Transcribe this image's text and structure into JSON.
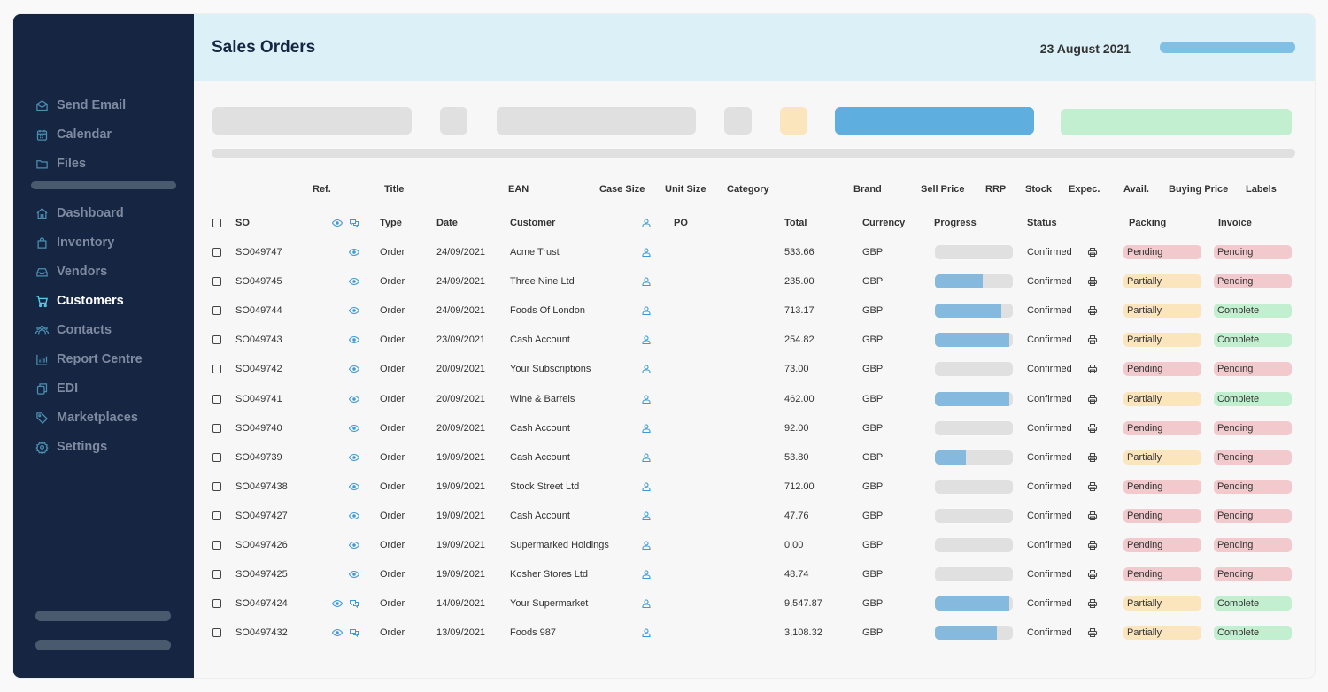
{
  "sidebar": {
    "top_items": [
      {
        "label": "Send Email",
        "icon": "mail-open-icon"
      },
      {
        "label": "Calendar",
        "icon": "calendar-icon"
      },
      {
        "label": "Files",
        "icon": "folder-icon"
      }
    ],
    "items": [
      {
        "label": "Dashboard",
        "icon": "home-icon"
      },
      {
        "label": "Inventory",
        "icon": "shopping-bag-icon"
      },
      {
        "label": "Vendors",
        "icon": "inbox-icon"
      },
      {
        "label": "Customers",
        "icon": "cart-icon",
        "active": true
      },
      {
        "label": "Contacts",
        "icon": "users-icon"
      },
      {
        "label": "Report Centre",
        "icon": "bar-chart-icon"
      },
      {
        "label": "EDI",
        "icon": "copy-icon"
      },
      {
        "label": "Marketplaces",
        "icon": "tag-icon"
      },
      {
        "label": "Settings",
        "icon": "gear-icon"
      }
    ]
  },
  "header": {
    "title": "Sales Orders",
    "date": "23 August 2021"
  },
  "colors": {
    "sidebar_bg": "#152542",
    "header_bg": "#dbf0f7",
    "accent_blue": "#5faee0",
    "pending": "#f2c9cd",
    "partially": "#fbe5bd",
    "complete": "#c2efcf"
  },
  "table": {
    "secondary_headers": [
      "Ref.",
      "Title",
      "EAN",
      "Case Size",
      "Unit Size",
      "Category",
      "Brand",
      "Sell Price",
      "RRP",
      "Stock",
      "Expec.",
      "Avail.",
      "Buying Price",
      "Labels"
    ],
    "headers": {
      "so": "SO",
      "type": "Type",
      "date": "Date",
      "customer": "Customer",
      "po": "PO",
      "total": "Total",
      "currency": "Currency",
      "progress": "Progress",
      "status": "Status",
      "packing": "Packing",
      "invoice": "Invoice"
    },
    "rows": [
      {
        "so": "SO049747",
        "comment": false,
        "type": "Order",
        "date": "24/09/2021",
        "customer": "Acme Trust",
        "po": "",
        "total": "533.66",
        "currency": "GBP",
        "progress": 0,
        "status": "Confirmed",
        "packing": "Pending",
        "invoice": "Pending"
      },
      {
        "so": "SO049745",
        "comment": false,
        "type": "Order",
        "date": "24/09/2021",
        "customer": "Three Nine Ltd",
        "po": "",
        "total": "235.00",
        "currency": "GBP",
        "progress": 61,
        "status": "Confirmed",
        "packing": "Partially",
        "invoice": "Pending"
      },
      {
        "so": "SO049744",
        "comment": false,
        "type": "Order",
        "date": "24/09/2021",
        "customer": "Foods Of London",
        "po": "",
        "total": "713.17",
        "currency": "GBP",
        "progress": 85,
        "status": "Confirmed",
        "packing": "Partially",
        "invoice": "Complete"
      },
      {
        "so": "SO049743",
        "comment": false,
        "type": "Order",
        "date": "23/09/2021",
        "customer": "Cash Account",
        "po": "",
        "total": "254.82",
        "currency": "GBP",
        "progress": 95,
        "status": "Confirmed",
        "packing": "Partially",
        "invoice": "Complete"
      },
      {
        "so": "SO049742",
        "comment": false,
        "type": "Order",
        "date": "20/09/2021",
        "customer": "Your Subscriptions",
        "po": "",
        "total": "73.00",
        "currency": "GBP",
        "progress": 0,
        "status": "Confirmed",
        "packing": "Pending",
        "invoice": "Pending"
      },
      {
        "so": "SO049741",
        "comment": false,
        "type": "Order",
        "date": "20/09/2021",
        "customer": "Wine & Barrels",
        "po": "",
        "total": "462.00",
        "currency": "GBP",
        "progress": 95,
        "status": "Confirmed",
        "packing": "Partially",
        "invoice": "Complete"
      },
      {
        "so": "SO049740",
        "comment": false,
        "type": "Order",
        "date": "20/09/2021",
        "customer": "Cash Account",
        "po": "",
        "total": "92.00",
        "currency": "GBP",
        "progress": 0,
        "status": "Confirmed",
        "packing": "Pending",
        "invoice": "Pending"
      },
      {
        "so": "SO049739",
        "comment": false,
        "type": "Order",
        "date": "19/09/2021",
        "customer": "Cash Account",
        "po": "",
        "total": "53.80",
        "currency": "GBP",
        "progress": 40,
        "status": "Confirmed",
        "packing": "Partially",
        "invoice": "Pending"
      },
      {
        "so": "SO0497438",
        "comment": false,
        "type": "Order",
        "date": "19/09/2021",
        "customer": "Stock Street Ltd",
        "po": "",
        "total": "712.00",
        "currency": "GBP",
        "progress": 0,
        "status": "Confirmed",
        "packing": "Pending",
        "invoice": "Pending"
      },
      {
        "so": "SO0497427",
        "comment": false,
        "type": "Order",
        "date": "19/09/2021",
        "customer": "Cash Account",
        "po": "",
        "total": "47.76",
        "currency": "GBP",
        "progress": 0,
        "status": "Confirmed",
        "packing": "Pending",
        "invoice": "Pending"
      },
      {
        "so": "SO0497426",
        "comment": false,
        "type": "Order",
        "date": "19/09/2021",
        "customer": "Supermarked Holdings",
        "po": "",
        "total": "0.00",
        "currency": "GBP",
        "progress": 0,
        "status": "Confirmed",
        "packing": "Pending",
        "invoice": "Pending"
      },
      {
        "so": "SO0497425",
        "comment": false,
        "type": "Order",
        "date": "19/09/2021",
        "customer": "Kosher Stores Ltd",
        "po": "",
        "total": "48.74",
        "currency": "GBP",
        "progress": 0,
        "status": "Confirmed",
        "packing": "Pending",
        "invoice": "Pending"
      },
      {
        "so": "SO0497424",
        "comment": true,
        "type": "Order",
        "date": "14/09/2021",
        "customer": "Your Supermarket",
        "po": "",
        "total": "9,547.87",
        "currency": "GBP",
        "progress": 95,
        "status": "Confirmed",
        "packing": "Partially",
        "invoice": "Complete"
      },
      {
        "so": "SO0497432",
        "comment": true,
        "type": "Order",
        "date": "13/09/2021",
        "customer": "Foods 987",
        "po": "",
        "total": "3,108.32",
        "currency": "GBP",
        "progress": 80,
        "status": "Confirmed",
        "packing": "Partially",
        "invoice": "Complete"
      }
    ]
  }
}
